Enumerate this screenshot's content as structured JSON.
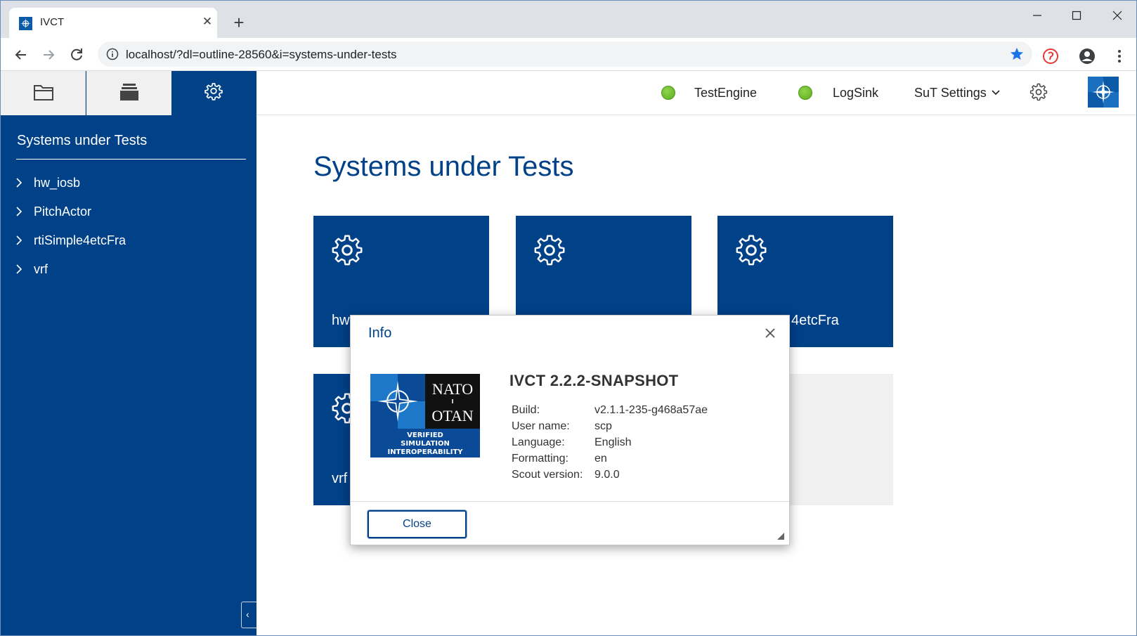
{
  "browser": {
    "tab_title": "IVCT",
    "tab_close": "✕",
    "new_tab": "+",
    "url": "localhost/?dl=outline-28560&i=systems-under-tests"
  },
  "sidebar": {
    "title": "Systems under Tests",
    "items": [
      {
        "label": "hw_iosb"
      },
      {
        "label": "PitchActor"
      },
      {
        "label": "rtiSimple4etcFra"
      },
      {
        "label": "vrf"
      }
    ],
    "collapse_glyph": "‹"
  },
  "header": {
    "status_items": [
      {
        "label": "TestEngine",
        "status_color": "#6cbf2a"
      },
      {
        "label": "LogSink",
        "status_color": "#6cbf2a"
      }
    ],
    "sut_settings_label": "SuT Settings"
  },
  "main": {
    "title": "Systems under Tests",
    "tiles": [
      {
        "label": "hw"
      },
      {
        "label": ""
      },
      {
        "label": "4etcFra"
      },
      {
        "label": "vrf"
      }
    ]
  },
  "dialog": {
    "title": "Info",
    "heading": "IVCT 2.2.2-SNAPSHOT",
    "logo_text": {
      "line1": "NATO",
      "line2": "OTAN",
      "caption1": "VERIFIED",
      "caption2": "SIMULATION",
      "caption3": "INTEROPERABILITY"
    },
    "properties": [
      {
        "key": "Build:",
        "value": "v2.1.1-235-g468a57ae"
      },
      {
        "key": "User name:",
        "value": "scp"
      },
      {
        "key": "Language:",
        "value": "English"
      },
      {
        "key": "Formatting:",
        "value": "en"
      },
      {
        "key": "Scout version:",
        "value": "9.0.0"
      }
    ],
    "close_button": "Close"
  },
  "colors": {
    "brand": "#014188",
    "status_ok": "#6cbf2a"
  }
}
